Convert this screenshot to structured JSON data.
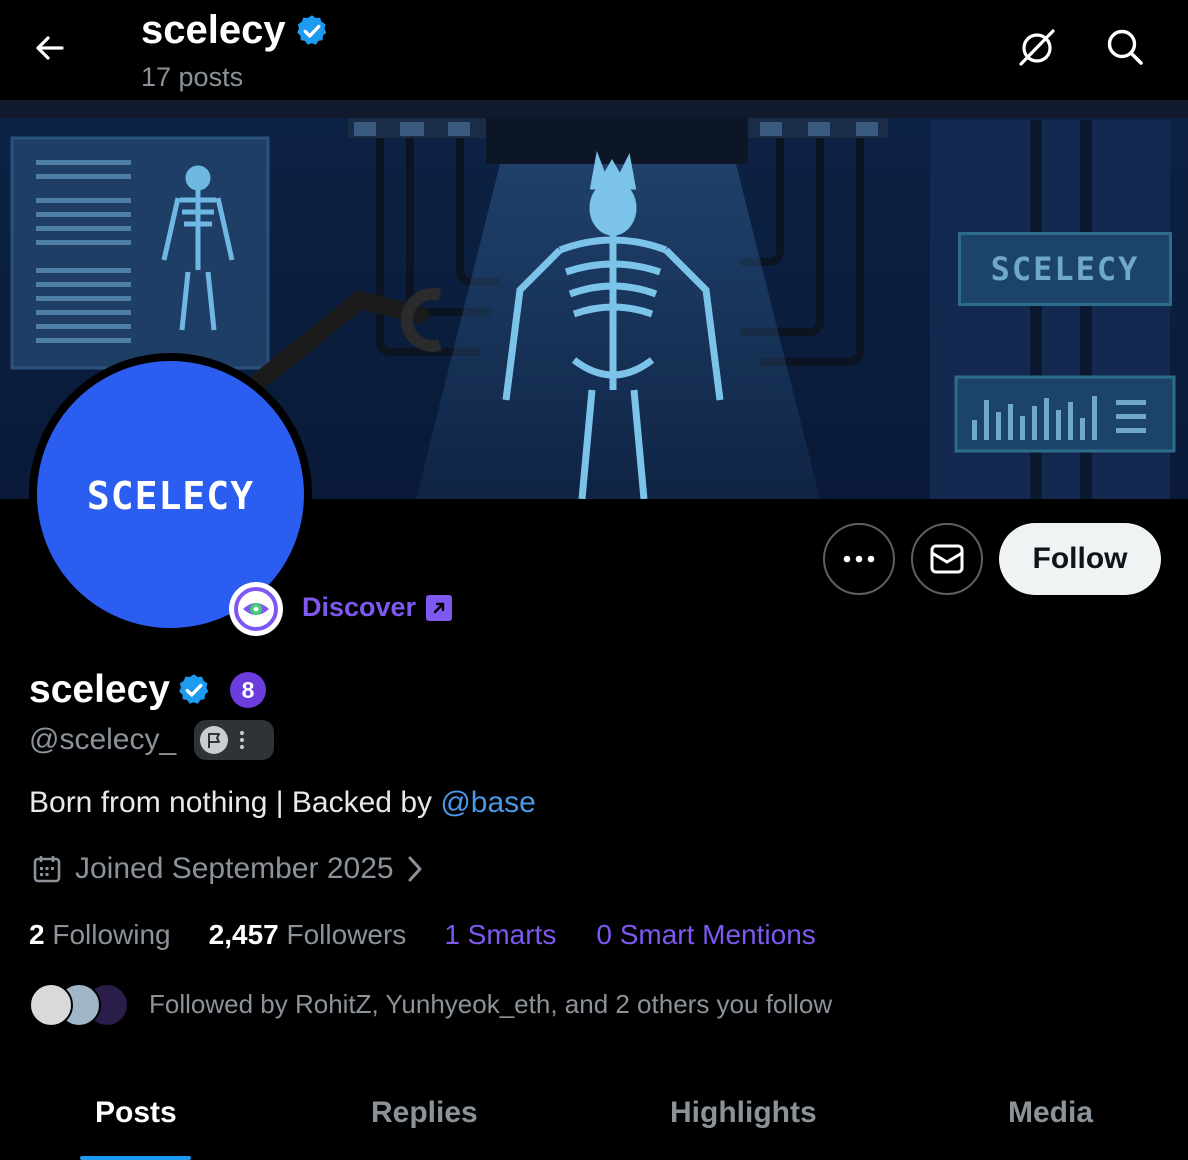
{
  "header": {
    "title": "scelecy",
    "posts_count": "17 posts"
  },
  "banner": {
    "label": "SCELECY"
  },
  "avatar": {
    "logo_text": "SCELECY"
  },
  "discover": {
    "label": "Discover"
  },
  "actions": {
    "follow_label": "Follow"
  },
  "profile": {
    "display_name": "scelecy",
    "score": "8",
    "handle": "@scelecy_",
    "bio_text": "Born from nothing | Backed by ",
    "bio_link": "@base",
    "joined": "Joined September 2025"
  },
  "stats": {
    "following_count": "2",
    "following_label": " Following",
    "followers_count": "2,457",
    "followers_label": " Followers",
    "smarts": "1 Smarts",
    "smart_mentions": "0 Smart Mentions"
  },
  "followed_by": {
    "text": "Followed by RohitZ, Yunhyeok_eth, and 2 others you follow"
  },
  "tabs": [
    {
      "label": "Posts"
    },
    {
      "label": "Replies"
    },
    {
      "label": "Highlights"
    },
    {
      "label": "Media"
    }
  ],
  "colors": {
    "accent_blue": "#1d9bf0",
    "verified": "#1d9bf0",
    "purple": "#7f57f1",
    "avatar_bg": "#2b5ef0"
  },
  "icons": {
    "back": "arrow-left-icon",
    "grok": "grok-icon",
    "search": "search-icon",
    "verified": "verified-badge-icon",
    "eye": "eye-icon",
    "more": "more-dots-icon",
    "message": "envelope-icon",
    "calendar": "calendar-icon",
    "chevron": "chevron-right-icon",
    "flag": "flag-icon"
  }
}
